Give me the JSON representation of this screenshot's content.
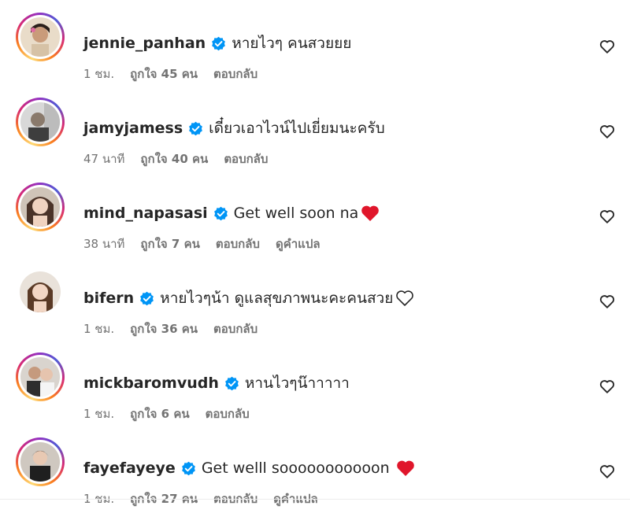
{
  "comments": [
    {
      "username": "jennie_panhan",
      "verified": true,
      "text": "หายไวๆ คนสวยยย",
      "time": "1 ชม.",
      "likes": "ถูกใจ 45 คน",
      "reply": "ตอบกลับ",
      "translate": "",
      "story_ring": true
    },
    {
      "username": "jamyjamess",
      "verified": true,
      "text": "เดี๋ยวเอาไวน์ไปเยี่ยมนะครับ",
      "time": "47 นาที",
      "likes": "ถูกใจ 40 คน",
      "reply": "ตอบกลับ",
      "translate": "",
      "story_ring": true
    },
    {
      "username": "mind_napasasi",
      "verified": true,
      "text": "Get well soon na",
      "time": "38 นาที",
      "likes": "ถูกใจ 7 คน",
      "reply": "ตอบกลับ",
      "translate": "ดูคำแปล",
      "story_ring": true,
      "emoji": "red-heart-emoji"
    },
    {
      "username": "bifern",
      "verified": true,
      "text": "หายไวๆน้า ดูแลสุขภาพนะคะคนสวย",
      "time": "1 ชม.",
      "likes": "ถูกใจ 36 คน",
      "reply": "ตอบกลับ",
      "translate": "",
      "story_ring": false,
      "emoji": "outline-heart-emoji"
    },
    {
      "username": "mickbaromvudh",
      "verified": true,
      "text": "หานไวๆน๊าาาาา",
      "time": "1 ชม.",
      "likes": "ถูกใจ 6 คน",
      "reply": "ตอบกลับ",
      "translate": "",
      "story_ring": true
    },
    {
      "username": "fayefayeye",
      "verified": true,
      "text": "Get welll sooooooooooon",
      "time": "1 ชม.",
      "likes": "ถูกใจ 27 คน",
      "reply": "ตอบกลับ",
      "translate": "ดูคำแปล",
      "story_ring": true,
      "emoji": "red-heart-emoji"
    }
  ],
  "colors": {
    "verified": "#0095f6",
    "heart": "#e0162b",
    "meta_text": "#737373"
  }
}
